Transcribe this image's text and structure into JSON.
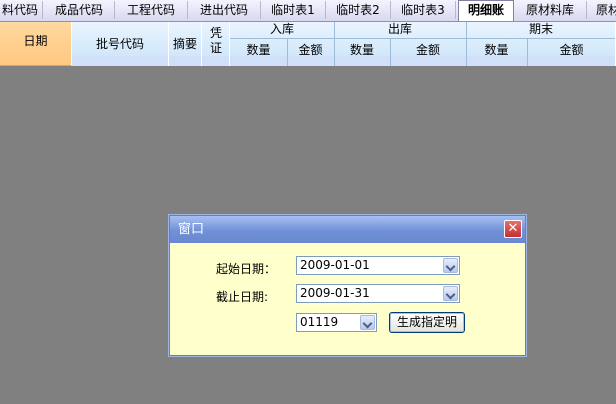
{
  "tabs": [
    {
      "label": "料代码"
    },
    {
      "label": "成品代码"
    },
    {
      "label": "工程代码"
    },
    {
      "label": "进出代码"
    },
    {
      "label": "临时表1"
    },
    {
      "label": "临时表2"
    },
    {
      "label": "临时表3"
    },
    {
      "label": "明细账",
      "active": true
    },
    {
      "label": "原材料库"
    },
    {
      "label": "原材"
    }
  ],
  "table_header": {
    "date": "日期",
    "batch_code": "批号代码",
    "summary": "摘要",
    "voucher": "凭证",
    "in_stock": "入库",
    "out_stock": "出库",
    "ending": "期末",
    "quantity": "数量",
    "amount": "金额"
  },
  "dialog": {
    "title": "窗口",
    "start_label": "起始日期：",
    "start_value": "2009-01-01",
    "end_label": "截止日期:",
    "end_value": "2009-01-31",
    "code_value": "01119",
    "generate_button": "生成指定明"
  }
}
